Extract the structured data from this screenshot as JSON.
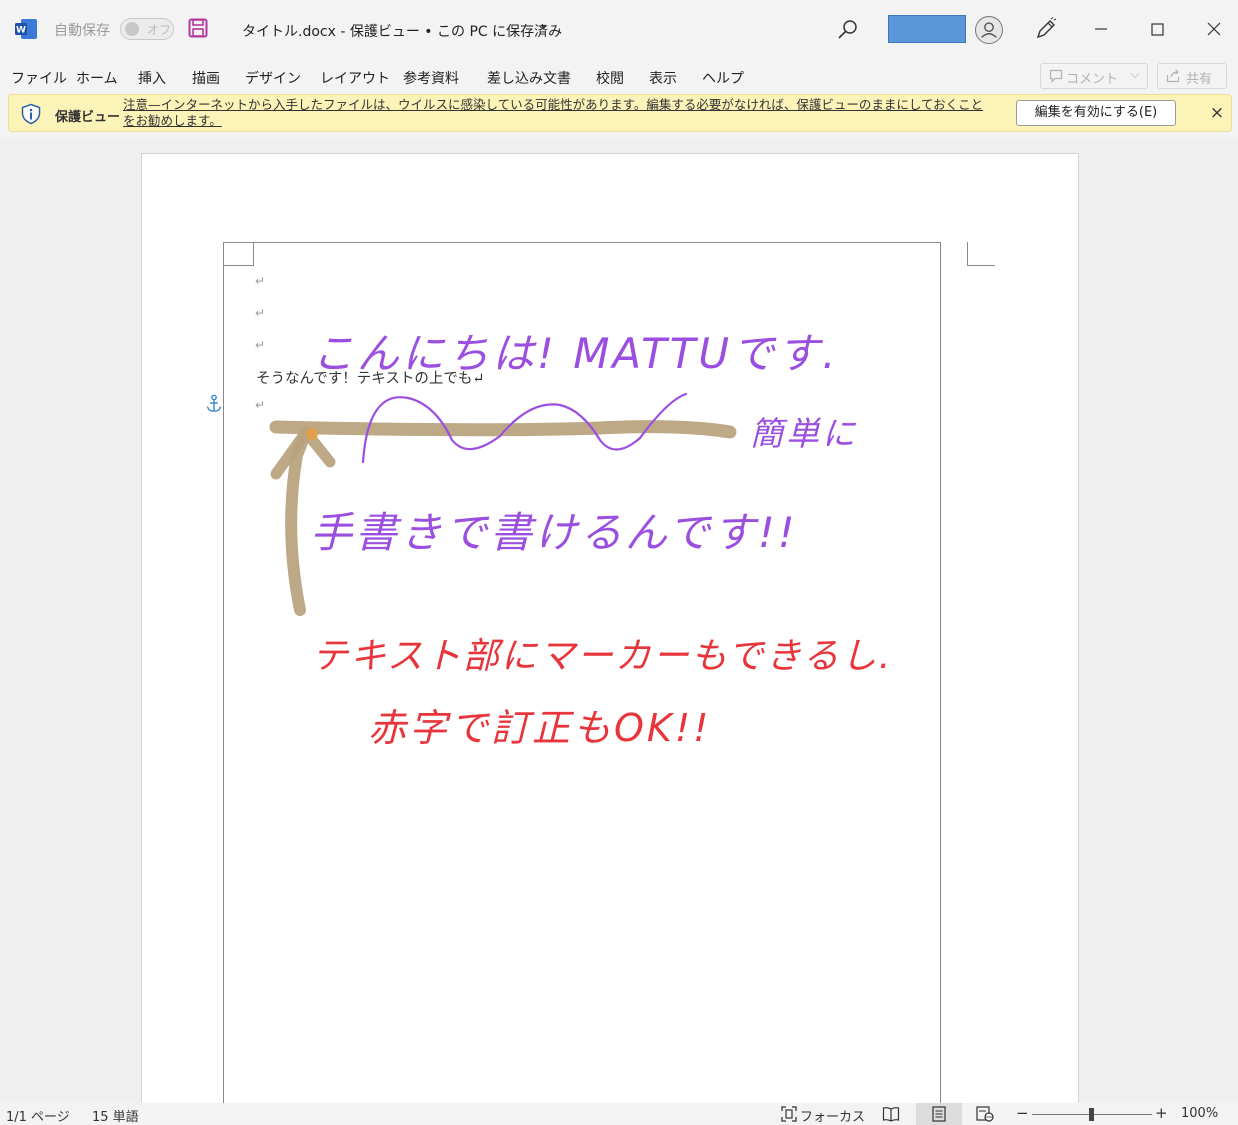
{
  "titlebar": {
    "app_icon": "word-logo-icon",
    "autosave_label": "自動保存",
    "autosave_state": "オフ",
    "save_icon": "save-icon",
    "doc_title": "タイトル.docx  -  保護ビュー • この PC に保存済み",
    "title_caret": "▾",
    "search_icon": "search-icon",
    "account_icon": "avatar-icon",
    "pen_icon": "pen-icon",
    "window_controls": [
      "minimize-icon",
      "maximize-icon",
      "close-icon"
    ]
  },
  "menu": {
    "items": [
      "ファイル",
      "ホーム",
      "挿入",
      "描画",
      "デザイン",
      "レイアウト",
      "参考資料",
      "差し込み文書",
      "校閲",
      "表示",
      "ヘルプ"
    ],
    "comment_label": "コメント",
    "share_label": "共有"
  },
  "protected_view": {
    "title": "保護ビュー",
    "message": "注意—インターネットから入手したファイルは、ウイルスに感染している可能性があります。編集する必要がなければ、保護ビューのままにしておくことをお勧めします。",
    "enable_button": "編集を有効にする(E)",
    "close": "×"
  },
  "document": {
    "para_mark": "↵",
    "body_text": "そうなんです！テキストの上でも↵",
    "handwriting": {
      "purple_line1": "こんにちは! MATTUです.",
      "purple_side": "簡単に",
      "purple_line2": "手書きで書けるんです!!",
      "red_line1": "テキスト部にマーカーもできるし.",
      "red_line2": "赤字で訂正もOK!!"
    },
    "ink_colors": {
      "purple": "#9b4fe0",
      "red": "#e8353b",
      "highlighter": "#b9a27d",
      "highlighter_tip": "#e5a040"
    }
  },
  "statusbar": {
    "pages": "1/1 ページ",
    "words": "15 単語",
    "focus": "フォーカス",
    "zoom_minus": "−",
    "zoom_plus": "+",
    "zoom": "100%",
    "zoom_level": 100
  }
}
